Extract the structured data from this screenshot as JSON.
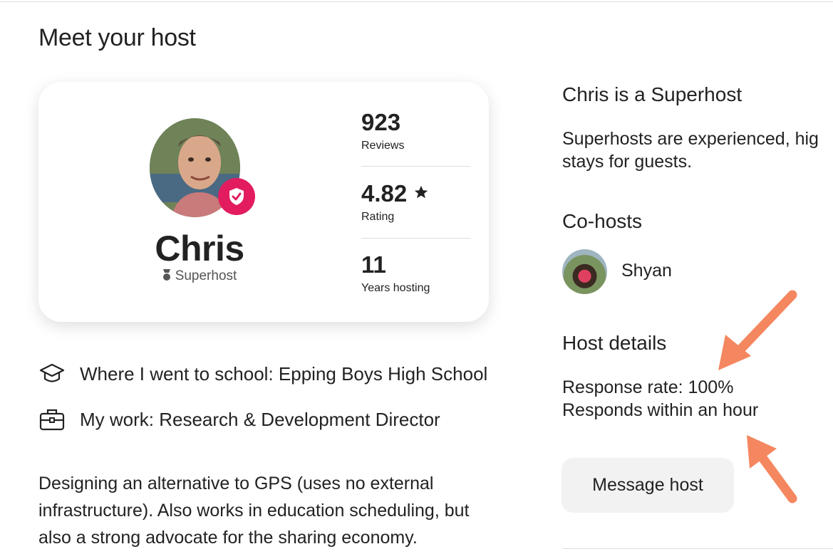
{
  "section": {
    "title": "Meet your host"
  },
  "host_card": {
    "name": "Chris",
    "role": "Superhost",
    "stats": [
      {
        "value": "923",
        "label": "Reviews"
      },
      {
        "value": "4.82",
        "label": "Rating",
        "suffix_icon": "star-icon"
      },
      {
        "value": "11",
        "label": "Years hosting"
      }
    ]
  },
  "host_info": {
    "school": "Where I went to school: Epping Boys High School",
    "work": "My work: Research & Development Director",
    "bio": "Designing an alternative to GPS (uses no external infrastructure). Also works in education scheduling, but also a strong advocate for the sharing economy."
  },
  "superhost": {
    "title": "Chris is a Superhost",
    "line1": "Superhosts are experienced, hig",
    "line2": "stays for guests."
  },
  "cohosts": {
    "title": "Co-hosts",
    "items": [
      {
        "name": "Shyan"
      }
    ]
  },
  "host_details": {
    "title": "Host details",
    "response_rate": "Response rate: 100%",
    "response_time": "Responds within an hour"
  },
  "actions": {
    "message_host": "Message host"
  },
  "colors": {
    "brand": "#e31c5f",
    "annotation_arrow": "#f4875f",
    "button_bg": "#f2f2f2"
  },
  "icons": [
    "graduation-cap-icon",
    "briefcase-icon",
    "superhost-medal-icon",
    "verified-shield-icon",
    "star-icon"
  ]
}
